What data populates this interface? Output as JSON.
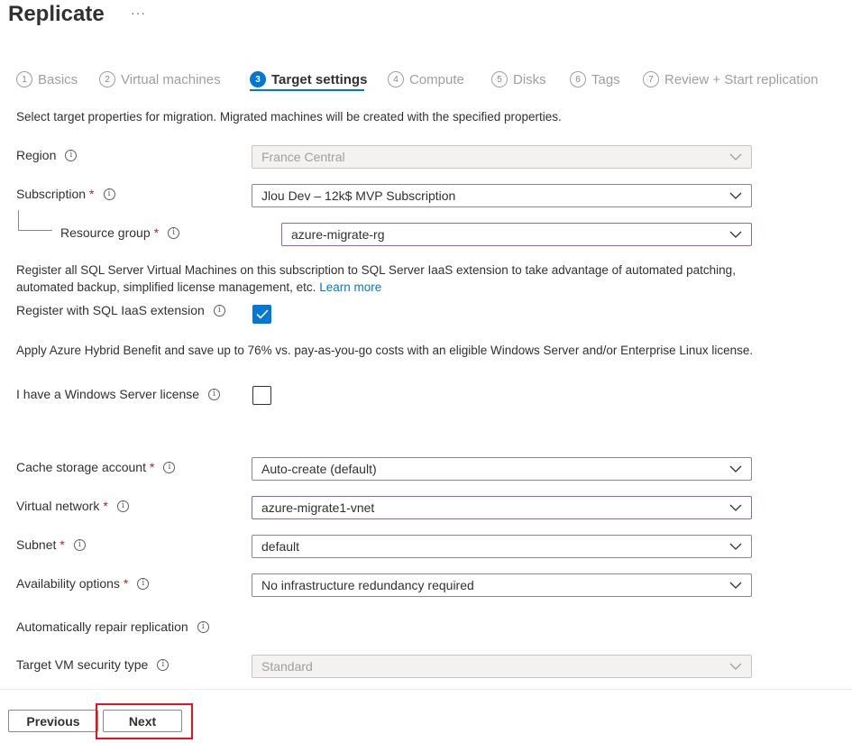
{
  "header": {
    "title": "Replicate",
    "more": "···"
  },
  "steps": [
    {
      "num": "1",
      "label": "Basics"
    },
    {
      "num": "2",
      "label": "Virtual machines"
    },
    {
      "num": "3",
      "label": "Target settings"
    },
    {
      "num": "4",
      "label": "Compute"
    },
    {
      "num": "5",
      "label": "Disks"
    },
    {
      "num": "6",
      "label": "Tags"
    },
    {
      "num": "7",
      "label": "Review + Start replication"
    }
  ],
  "active_step": "Target settings",
  "description": "Select target properties for migration. Migrated machines will be created with the specified properties.",
  "info_glyph": "i",
  "required_mark": "*",
  "fields": {
    "region": {
      "label": "Region",
      "value": "France Central"
    },
    "subscription": {
      "label": "Subscription",
      "value": "Jlou Dev – 12k$ MVP Subscription"
    },
    "resource_group": {
      "label": "Resource group",
      "value": "azure-migrate-rg"
    },
    "cache_storage": {
      "label": "Cache storage account",
      "value": "Auto-create (default)"
    },
    "vnet": {
      "label": "Virtual network",
      "value": "azure-migrate1-vnet"
    },
    "subnet": {
      "label": "Subnet",
      "value": "default"
    },
    "availability": {
      "label": "Availability options",
      "value": "No infrastructure redundancy required"
    },
    "auto_repair": {
      "label": "Automatically repair replication"
    },
    "security_type": {
      "label": "Target VM security type",
      "value": "Standard"
    }
  },
  "sql": {
    "text": "Register all SQL Server Virtual Machines on this subscription to SQL Server IaaS extension to take advantage of automated patching, automated backup, simplified license management, etc.",
    "link": "Learn more",
    "checkbox_label": "Register with SQL IaaS extension",
    "checked": true
  },
  "hybrid": {
    "text": "Apply Azure Hybrid Benefit and save up to 76% vs. pay-as-you-go costs with an eligible Windows Server and/or Enterprise Linux license.",
    "checkbox_label": "I have a Windows Server license",
    "checked": false
  },
  "footer": {
    "previous": "Previous",
    "next": "Next"
  },
  "colors": {
    "accent": "#0078d4",
    "highlight": "#e81123",
    "required": "#a4262c",
    "focus_border": "#8764b8"
  },
  "icons": {
    "info": "info-icon",
    "chevron": "chevron-down-icon",
    "check": "checkmark-icon"
  }
}
